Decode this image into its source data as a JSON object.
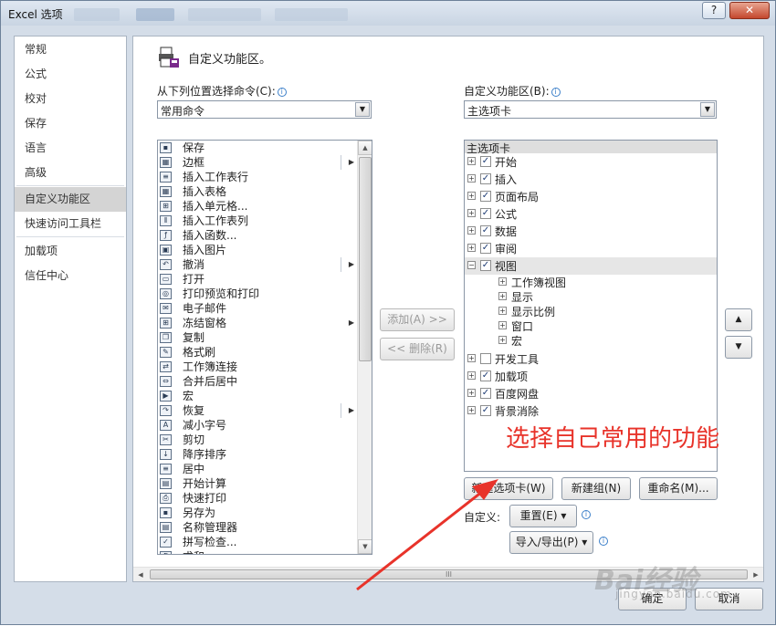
{
  "window": {
    "title": "Excel 选项",
    "help_label": "?",
    "close_label": "✕"
  },
  "nav": {
    "items": [
      {
        "label": "常规"
      },
      {
        "label": "公式"
      },
      {
        "label": "校对"
      },
      {
        "label": "保存"
      },
      {
        "label": "语言"
      },
      {
        "label": "高级"
      },
      {
        "label": "自定义功能区"
      },
      {
        "label": "快速访问工具栏"
      },
      {
        "label": "加载项"
      },
      {
        "label": "信任中心"
      }
    ],
    "active_index": 6
  },
  "header": {
    "title": "自定义功能区。",
    "icon": "customize-ribbon-icon"
  },
  "left": {
    "label": "从下列位置选择命令(C):",
    "combo_value": "常用命令",
    "commands": [
      {
        "label": "保存",
        "icon": "save-icon",
        "arrow": false
      },
      {
        "label": "边框",
        "icon": "borders-icon",
        "arrow": true,
        "sep": true
      },
      {
        "label": "插入工作表行",
        "icon": "insert-rows-icon",
        "arrow": false
      },
      {
        "label": "插入表格",
        "icon": "insert-table-icon",
        "arrow": false
      },
      {
        "label": "插入单元格...",
        "icon": "insert-cells-icon",
        "arrow": false
      },
      {
        "label": "插入工作表列",
        "icon": "insert-columns-icon",
        "arrow": false
      },
      {
        "label": "插入函数...",
        "icon": "function-icon",
        "arrow": false
      },
      {
        "label": "插入图片",
        "icon": "picture-icon",
        "arrow": false
      },
      {
        "label": "撤消",
        "icon": "undo-icon",
        "arrow": true,
        "sep": true
      },
      {
        "label": "打开",
        "icon": "open-folder-icon",
        "arrow": false
      },
      {
        "label": "打印预览和打印",
        "icon": "print-preview-icon",
        "arrow": false
      },
      {
        "label": "电子邮件",
        "icon": "email-icon",
        "arrow": false
      },
      {
        "label": "冻结窗格",
        "icon": "freeze-panes-icon",
        "arrow": true
      },
      {
        "label": "复制",
        "icon": "copy-icon",
        "arrow": false
      },
      {
        "label": "格式刷",
        "icon": "format-painter-icon",
        "arrow": false
      },
      {
        "label": "工作簿连接",
        "icon": "connections-icon",
        "arrow": false
      },
      {
        "label": "合并后居中",
        "icon": "merge-center-icon",
        "arrow": false
      },
      {
        "label": "宏",
        "icon": "macro-icon",
        "arrow": false
      },
      {
        "label": "恢复",
        "icon": "redo-icon",
        "arrow": true,
        "sep": true
      },
      {
        "label": "减小字号",
        "icon": "decrease-font-icon",
        "arrow": false
      },
      {
        "label": "剪切",
        "icon": "cut-icon",
        "arrow": false
      },
      {
        "label": "降序排序",
        "icon": "sort-desc-icon",
        "arrow": false
      },
      {
        "label": "居中",
        "icon": "align-center-icon",
        "arrow": false
      },
      {
        "label": "开始计算",
        "icon": "calculate-icon",
        "arrow": false
      },
      {
        "label": "快速打印",
        "icon": "quick-print-icon",
        "arrow": false
      },
      {
        "label": "另存为",
        "icon": "save-as-icon",
        "arrow": false
      },
      {
        "label": "名称管理器",
        "icon": "name-manager-icon",
        "arrow": false
      },
      {
        "label": "拼写检查...",
        "icon": "spelling-icon",
        "arrow": false
      },
      {
        "label": "求和",
        "icon": "sum-icon",
        "arrow": false
      }
    ]
  },
  "middle": {
    "add_label": "添加(A) >>",
    "remove_label": "<< 删除(R)"
  },
  "right": {
    "label": "自定义功能区(B):",
    "combo_value": "主选项卡",
    "tree_header": "主选项卡",
    "tabs": [
      {
        "label": "开始",
        "checked": true,
        "expanded": false
      },
      {
        "label": "插入",
        "checked": true,
        "expanded": false
      },
      {
        "label": "页面布局",
        "checked": true,
        "expanded": false
      },
      {
        "label": "公式",
        "checked": true,
        "expanded": false
      },
      {
        "label": "数据",
        "checked": true,
        "expanded": false
      },
      {
        "label": "审阅",
        "checked": true,
        "expanded": false
      },
      {
        "label": "视图",
        "checked": true,
        "expanded": true,
        "selected": true,
        "groups": [
          "工作簿视图",
          "显示",
          "显示比例",
          "窗口",
          "宏"
        ]
      },
      {
        "label": "开发工具",
        "checked": false,
        "expanded": false
      },
      {
        "label": "加载项",
        "checked": true,
        "expanded": false
      },
      {
        "label": "百度网盘",
        "checked": true,
        "expanded": false
      },
      {
        "label": "背景消除",
        "checked": true,
        "expanded": false
      }
    ],
    "new_tab_label": "新建选项卡(W)",
    "new_group_label": "新建组(N)",
    "rename_label": "重命名(M)...",
    "customize_label": "自定义:",
    "reset_label": "重置(E) ▾",
    "import_export_label": "导入/导出(P) ▾",
    "move_up": "▲",
    "move_down": "▼"
  },
  "footer": {
    "ok_label": "确定",
    "cancel_label": "取消",
    "hscroll_grip": "III"
  },
  "annotation": {
    "text": "选择自己常用的功能",
    "color": "#e8332a"
  },
  "watermark": {
    "text": "Bai经验",
    "sub": "jingyan.baidu.com"
  }
}
